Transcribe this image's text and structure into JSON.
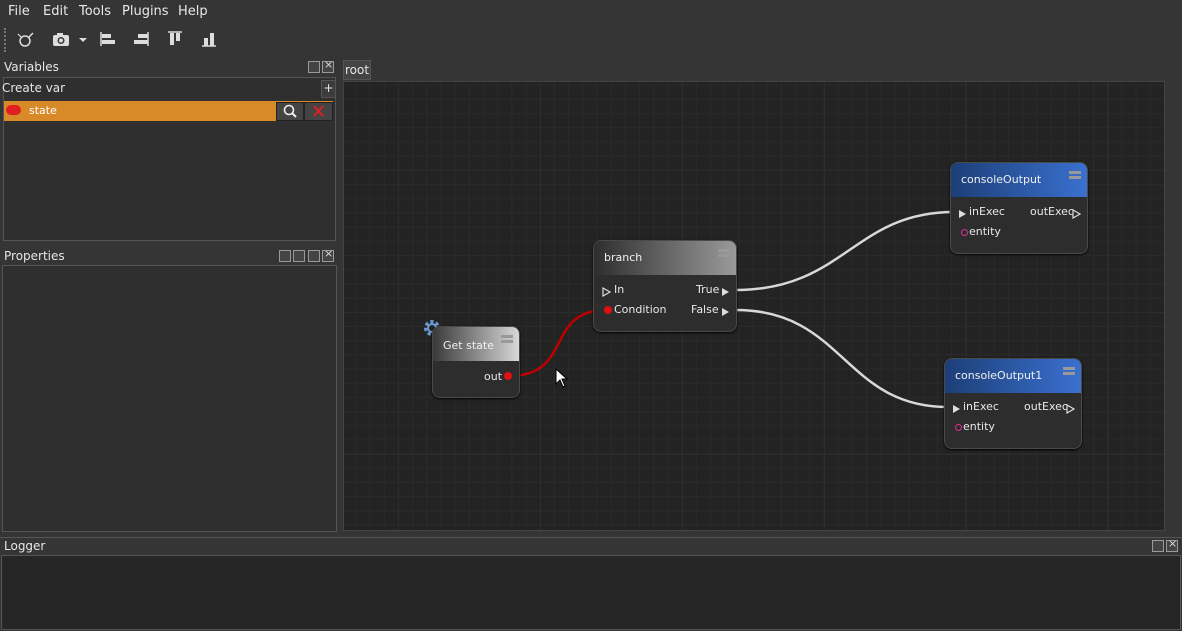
{
  "menu": [
    "File",
    "Edit",
    "Tools",
    "Plugins",
    "Help"
  ],
  "toolbar": {
    "icons": [
      "plugin-icon",
      "camera-icon",
      "dropdown-arrow-icon",
      "align-left-icon",
      "align-right-icon",
      "align-top-icon",
      "align-bottom-icon"
    ]
  },
  "variables_panel": {
    "title": "Variables",
    "create_label": "Create var",
    "add_label": "+",
    "items": [
      {
        "name": "state",
        "color": "#e02020"
      }
    ]
  },
  "properties_panel": {
    "title": "Properties"
  },
  "logger_panel": {
    "title": "Logger"
  },
  "graph": {
    "tab": "root",
    "nodes": {
      "get_state": {
        "title": "Get state",
        "out": "out"
      },
      "branch": {
        "title": "branch",
        "in": "In",
        "condition": "Condition",
        "true": "True",
        "false": "False"
      },
      "console1": {
        "title": "consoleOutput",
        "inExec": "inExec",
        "outExec": "outExec",
        "entity": "entity"
      },
      "console2": {
        "title": "consoleOutput1",
        "inExec": "inExec",
        "outExec": "outExec",
        "entity": "entity"
      }
    }
  },
  "colors": {
    "accent": "#d98a28",
    "exec_pin": "#e0e0e0",
    "bool_pin": "#e01010",
    "entity_pin": "#e03090",
    "console_header": "#2d5fb8"
  }
}
